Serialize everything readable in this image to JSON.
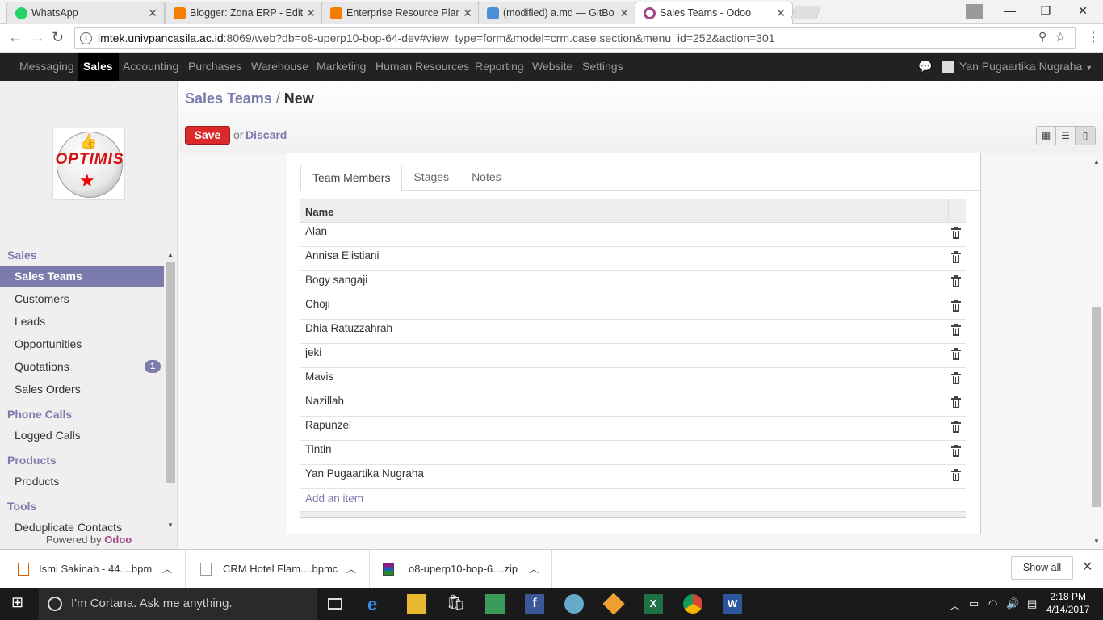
{
  "browser": {
    "tabs": [
      {
        "title": "WhatsApp",
        "favicon_color": "#25d366",
        "active": false
      },
      {
        "title": "Blogger: Zona ERP - Edit",
        "favicon_color": "#f57d00",
        "active": false
      },
      {
        "title": "Enterprise Resource Plan",
        "favicon_color": "#f57d00",
        "active": false
      },
      {
        "title": "(modified) a.md — GitBo",
        "favicon_color": "#4a90d9",
        "active": false
      },
      {
        "title": "Sales Teams - Odoo",
        "favicon_color": "#a24689",
        "active": true
      }
    ],
    "url_host": "imtek.univpancasila.ac.id",
    "url_rest": ":8069/web?db=o8-uperp10-bop-64-dev#view_type=form&model=crm.case.section&menu_id=252&action=301"
  },
  "topmenu": {
    "items": [
      "Messaging",
      "Sales",
      "Accounting",
      "Purchases",
      "Warehouse",
      "Marketing",
      "Human Resources",
      "Reporting",
      "Website",
      "Settings"
    ],
    "active": "Sales",
    "user": "Yan Pugaartika Nugraha"
  },
  "logo": {
    "text": "OPTIMIS"
  },
  "sidebar": {
    "sections": [
      {
        "title": "Sales",
        "items": [
          {
            "label": "Sales Teams",
            "active": true
          },
          {
            "label": "Customers"
          },
          {
            "label": "Leads"
          },
          {
            "label": "Opportunities"
          },
          {
            "label": "Quotations",
            "badge": "1"
          },
          {
            "label": "Sales Orders"
          }
        ]
      },
      {
        "title": "Phone Calls",
        "items": [
          {
            "label": "Logged Calls"
          }
        ]
      },
      {
        "title": "Products",
        "items": [
          {
            "label": "Products"
          }
        ]
      },
      {
        "title": "Tools",
        "items": [
          {
            "label": "Deduplicate Contacts"
          }
        ]
      }
    ],
    "powered_by": "Powered by",
    "powered_brand": "Odoo"
  },
  "header": {
    "breadcrumb_parent": "Sales Teams",
    "breadcrumb_sep": "/",
    "breadcrumb_current": "New",
    "save_label": "Save",
    "or_label": "or",
    "discard_label": "Discard"
  },
  "form": {
    "tabs": [
      "Team Members",
      "Stages",
      "Notes"
    ],
    "active_tab": "Team Members",
    "grid_header": "Name",
    "members": [
      "Alan",
      "Annisa Elistiani",
      "Bogy sangaji",
      "Choji",
      "Dhia Ratuzzahrah",
      "jeki",
      "Mavis",
      "Nazillah",
      "Rapunzel",
      "Tintin",
      "Yan Pugaartika Nugraha"
    ],
    "add_item": "Add an item"
  },
  "downloads": {
    "items": [
      "Ismi Sakinah - 44....bpm",
      "CRM Hotel Flam....bpmc",
      "o8-uperp10-bop-6....zip"
    ],
    "show_all": "Show all"
  },
  "taskbar": {
    "cortana": "I'm Cortana. Ask me anything.",
    "time": "2:18 PM",
    "date": "4/14/2017"
  }
}
